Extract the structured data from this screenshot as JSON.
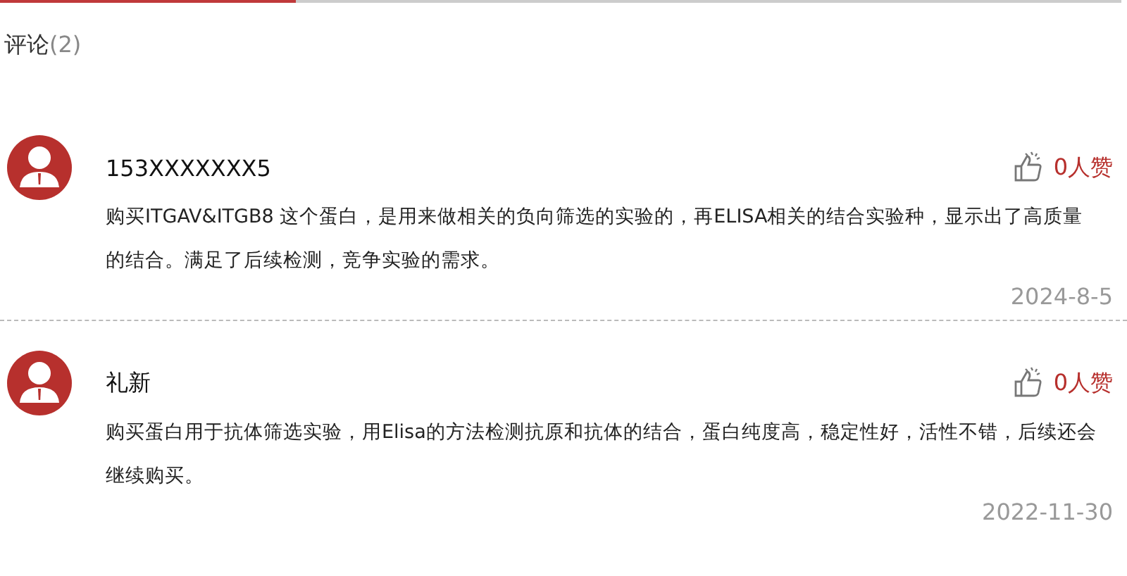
{
  "section": {
    "title": "评论",
    "count": "(2)"
  },
  "comments": [
    {
      "user": "153XXXXXXX5",
      "likes": "0人赞",
      "text": "购买ITGAV&ITGB8 这个蛋白，是用来做相关的负向筛选的实验的，再ELISA相关的结合实验种，显示出了高质量的结合。满足了后续检测，竞争实验的需求。",
      "date": "2024-8-5"
    },
    {
      "user": "礼新",
      "likes": "0人赞",
      "text": "购买蛋白用于抗体筛选实验，用Elisa的方法检测抗原和抗体的结合，蛋白纯度高，稳定性好，活性不错，后续还会继续购买。",
      "date": "2022-11-30"
    }
  ]
}
